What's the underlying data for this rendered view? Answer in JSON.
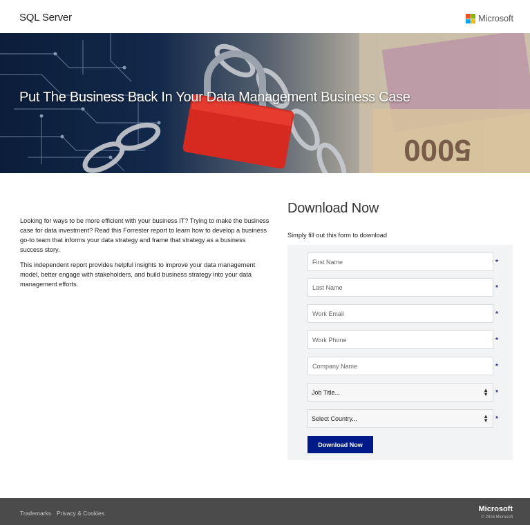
{
  "header": {
    "product_name": "SQL Server",
    "brand": "Microsoft",
    "brand_colors": [
      "#f25022",
      "#7fba00",
      "#00a4ef",
      "#ffb900"
    ]
  },
  "hero": {
    "title": "Put The Business Back In Your Data Management Business Case"
  },
  "intro": {
    "paragraph_1": "Looking for ways to be more efficient with your business IT? Trying to make the business case for data investment? Read this Forrester report to learn how to develop a business go-to team that informs your data strategy and frame that strategy as a business success story.",
    "paragraph_2": "This independent report provides helpful insights to improve your data management model, better engage with stakeholders, and build business strategy into your data management efforts."
  },
  "form": {
    "heading": "Download Now",
    "subheading": "Simply fill out this form to download",
    "required_mark": "*",
    "first_name_placeholder": "First Name",
    "last_name_placeholder": "Last Name",
    "work_email_placeholder": "Work Email",
    "work_phone_placeholder": "Work Phone",
    "company_name_placeholder": "Company Name",
    "job_title_selected": "Job Title...",
    "country_selected": "Select Country...",
    "submit_label": "Download Now",
    "submit_color": "#001a8a"
  },
  "footer": {
    "links": [
      "Trademarks",
      "Privacy & Cookies"
    ],
    "brand": "Microsoft",
    "copyright": "© 2016 Microsoft"
  }
}
